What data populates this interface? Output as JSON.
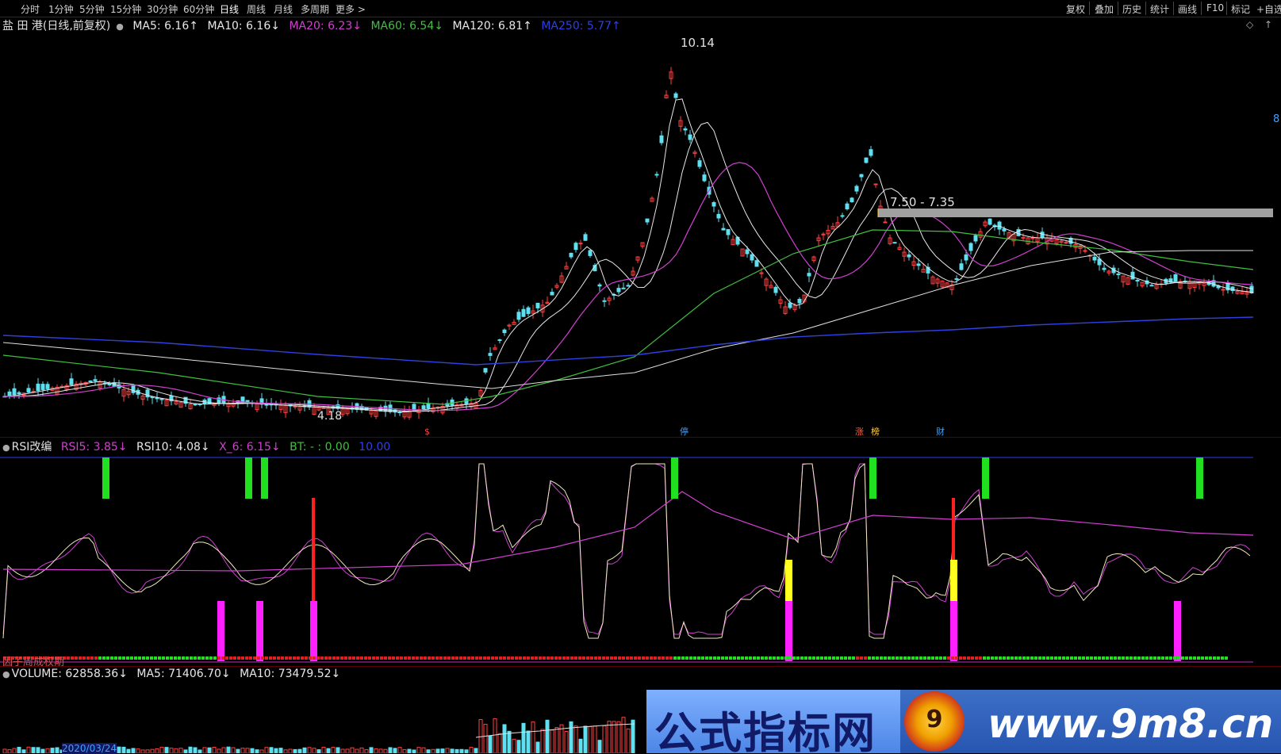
{
  "toolbar": {
    "periods": [
      "分时",
      "1分钟",
      "5分钟",
      "15分钟",
      "30分钟",
      "60分钟",
      "日线",
      "周线",
      "月线",
      "多周期",
      "更多 >"
    ],
    "active_period": "日线",
    "right_buttons": [
      "复权",
      "叠加",
      "历史",
      "统计",
      "画线",
      "F10",
      "标记",
      "+自选"
    ]
  },
  "main_legend": {
    "title": "盐 田 港(日线,前复权)",
    "items": [
      {
        "text": "MA5: 6.16↑",
        "color": "#e8e8e8"
      },
      {
        "text": "MA10: 6.16↓",
        "color": "#e8e8e8"
      },
      {
        "text": "MA20: 6.23↓",
        "color": "#d040d0"
      },
      {
        "text": "MA60: 6.54↓",
        "color": "#40c040"
      },
      {
        "text": "MA120: 6.81↑",
        "color": "#e8e8e8"
      },
      {
        "text": "MA250: 5.77↑",
        "color": "#3040e0"
      }
    ]
  },
  "price_labels": {
    "high": "10.14",
    "low": "4.18",
    "range_box": "7.50 - 7.35"
  },
  "event_markers": [
    {
      "text": "$",
      "color": "#ff4040"
    },
    {
      "text": "停",
      "color": "#40a0ff"
    },
    {
      "text": "涨",
      "color": "#ff6040"
    },
    {
      "text": "榜",
      "color": "#ffd040"
    },
    {
      "text": "财",
      "color": "#40a0ff"
    }
  ],
  "rsi_legend": {
    "title": "RSI改编",
    "items": [
      {
        "text": "RSI5: 3.85↓",
        "color": "#d040d0"
      },
      {
        "text": "RSI10: 4.08↓",
        "color": "#e8e8e8"
      },
      {
        "text": "X_6: 6.15↓",
        "color": "#d040d0"
      },
      {
        "text": "BT: - : 0.00",
        "color": "#40c040"
      },
      {
        "text": "10.00",
        "color": "#3040e0"
      }
    ],
    "bottom_label": "因子周成权期"
  },
  "volume_legend": {
    "items": [
      {
        "text": "VOLUME: 62858.36↓",
        "color": "#e8e8e8"
      },
      {
        "text": "MA5: 71406.70↓",
        "color": "#e8e8e8"
      },
      {
        "text": "MA10: 73479.52↓",
        "color": "#e8e8e8"
      }
    ],
    "date_label": "2020/03/24"
  },
  "watermark": {
    "name": "公式指标网",
    "url": "www.9m8.cn",
    "logo_glyph": "9"
  },
  "right_edge_label": "8"
}
